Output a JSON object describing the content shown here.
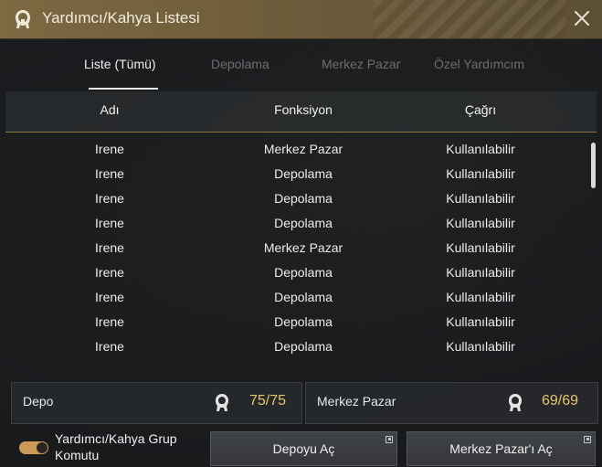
{
  "window": {
    "title": "Yardımcı/Kahya Listesi",
    "title_icon": "helper-silhouette-icon",
    "close_icon": "close-icon"
  },
  "tabs": [
    {
      "label": "Liste (Tümü)",
      "active": true
    },
    {
      "label": "Depolama",
      "active": false
    },
    {
      "label": "Merkez Pazar",
      "active": false
    },
    {
      "label": "Özel Yardımcım",
      "active": false
    }
  ],
  "table": {
    "headers": {
      "name": "Adı",
      "function": "Fonksiyon",
      "call": "Çağrı"
    },
    "rows": [
      {
        "name": "Irene",
        "function": "Merkez Pazar",
        "call": "Kullanılabilir"
      },
      {
        "name": "Irene",
        "function": "Depolama",
        "call": "Kullanılabilir"
      },
      {
        "name": "Irene",
        "function": "Depolama",
        "call": "Kullanılabilir"
      },
      {
        "name": "Irene",
        "function": "Depolama",
        "call": "Kullanılabilir"
      },
      {
        "name": "Irene",
        "function": "Merkez Pazar",
        "call": "Kullanılabilir"
      },
      {
        "name": "Irene",
        "function": "Depolama",
        "call": "Kullanılabilir"
      },
      {
        "name": "Irene",
        "function": "Depolama",
        "call": "Kullanılabilir"
      },
      {
        "name": "Irene",
        "function": "Depolama",
        "call": "Kullanılabilir"
      },
      {
        "name": "Irene",
        "function": "Depolama",
        "call": "Kullanılabilir"
      }
    ]
  },
  "stats": {
    "storage": {
      "label": "Depo",
      "value": "75/75"
    },
    "market": {
      "label": "Merkez Pazar",
      "value": "69/69"
    }
  },
  "footer": {
    "toggle_label": "Yardımcı/Kahya Grup Komutu",
    "toggle_on": true,
    "open_storage_button": "Depoyu Aç",
    "open_market_button": "Merkez Pazar'ı Aç"
  },
  "colors": {
    "title_bar": "#7d6942",
    "value_gold": "#e7c56b",
    "toggle": "#c89a55"
  }
}
